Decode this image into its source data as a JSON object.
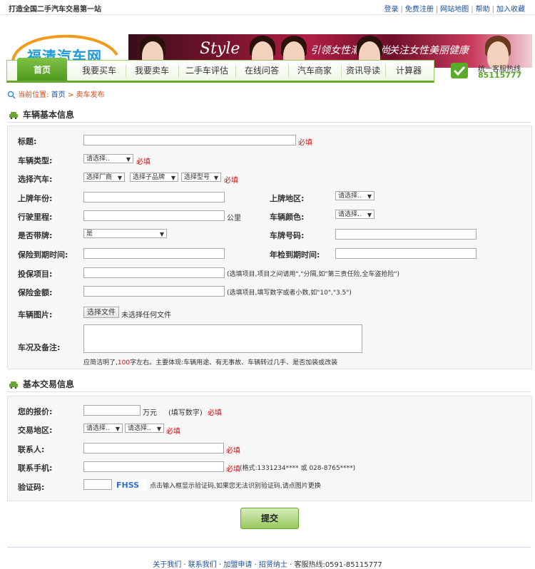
{
  "topbar": {
    "slogan": "打造全国二手汽车交易第一站",
    "links": [
      "登录",
      "免费注册",
      "网站地图",
      "帮助",
      "加入收藏"
    ]
  },
  "logo": {
    "text": "福清汽车网"
  },
  "banner": {
    "text1": "Style",
    "text2": "引领女性潮流时尚",
    "text3": "关注女性美丽健康"
  },
  "nav": {
    "items": [
      "首页",
      "我要买车",
      "我要卖车",
      "二手车评估",
      "在线问答",
      "汽车商家",
      "资讯导读",
      "计算器"
    ]
  },
  "hotline": {
    "label": "统一客服热线",
    "number": "85115777"
  },
  "breadcrumb": {
    "prefix": "当前位置:",
    "home": "首页",
    "sep": ">",
    "current": "卖车发布"
  },
  "vehicle": {
    "title": "车辆基本信息",
    "labels": {
      "title": "标题:",
      "type": "车辆类型:",
      "car": "选择汽车:",
      "year": "上牌年份:",
      "region": "上牌地区:",
      "mileage": "行驶里程:",
      "color": "车辆颜色:",
      "plate": "是否带牌:",
      "plateno": "车牌号码:",
      "insurance_exp": "保险到期时间:",
      "inspection_exp": "年检到期时间:",
      "ins_items": "投保项目:",
      "ins_amount": "保险金额:",
      "photo": "车辆图片:",
      "remarks": "车况及备注:"
    },
    "required": "必填",
    "type_select": "请选择..",
    "brand_select": "选择厂商",
    "sub_brand_select": "选择子品牌",
    "model_select": "选择型号",
    "region_select": "请选择..",
    "color_select": "请选择..",
    "plate_select": "是",
    "mileage_unit": "公里",
    "ins_items_hint": "(选填项目,项目之间请用\",\"分隔,如\"第三责任险,全车盗抢险\")",
    "ins_amount_hint": "(选填项目,填写数字或者小数,如\"10\",\"3.5\")",
    "file_button": "选择文件",
    "file_status": "未选择任何文件",
    "remarks_hint_a": "应简洁明了,",
    "remarks_hint_b": "100",
    "remarks_hint_c": "字左右。主要体现:车辆用途、有无事故、车辆转过几手、是否加装或改装"
  },
  "trade": {
    "title": "基本交易信息",
    "labels": {
      "price": "您的报价:",
      "region": "交易地区:",
      "contact": "联系人:",
      "mobile": "联系手机:",
      "captcha": "验证码:"
    },
    "price_unit": "万元",
    "price_hint": "(填写数字)",
    "required": "必填",
    "region_select1": "请选择..",
    "region_select2": "请选择..",
    "mobile_hint": "(格式:1331234**** 或 028-8765****)",
    "captcha_image_text": "FHSS",
    "captcha_hint": "点击输入框显示验证码,如果您无法识别验证码,请点图片更换"
  },
  "submit": "提交",
  "footer": {
    "links": [
      "关于我们",
      "联系我们",
      "加盟申请",
      "招贤纳士"
    ],
    "hotline": "客服热线:0591-85115777"
  },
  "colors": {
    "accent": "#6aa531",
    "link": "#1a4fa0",
    "required": "#d01010"
  }
}
